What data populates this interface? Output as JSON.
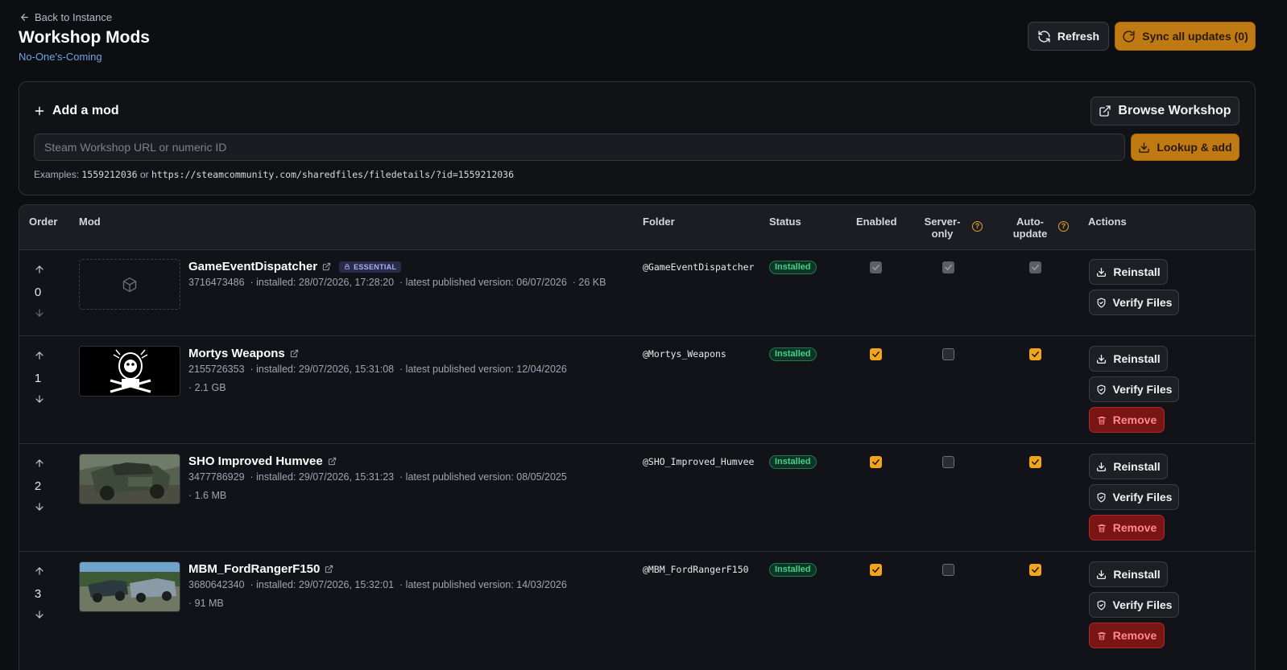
{
  "header": {
    "back_label": "Back to Instance",
    "title": "Workshop Mods",
    "subtitle": "No-One's-Coming",
    "refresh_label": "Refresh",
    "sync_label": "Sync all updates (0)"
  },
  "add_mod": {
    "title": "Add a mod",
    "browse_label": "Browse Workshop",
    "input_placeholder": "Steam Workshop URL or numeric ID",
    "input_value": "",
    "lookup_label": "Lookup & add",
    "examples_prefix": "Examples:",
    "example_id": "1559212036",
    "examples_or": "or",
    "example_url": "https://steamcommunity.com/sharedfiles/filedetails/?id=1559212036"
  },
  "table": {
    "columns": {
      "order": "Order",
      "mod": "Mod",
      "folder": "Folder",
      "status": "Status",
      "enabled": "Enabled",
      "server_only": "Server-only",
      "server_only_l1": "Server-",
      "server_only_l2": "only",
      "auto_update_l1": "Auto-",
      "auto_update_l2": "update",
      "actions": "Actions"
    },
    "actions": {
      "reinstall": "Reinstall",
      "verify": "Verify Files",
      "remove": "Remove"
    },
    "rows": [
      {
        "order": "0",
        "name": "GameEventDispatcher",
        "badge": "ESSENTIAL",
        "id": "3716473486",
        "installed": "· installed: 28/07/2026, 17:28:20",
        "latest": "· latest published version: 06/07/2026",
        "size": "· 26 KB",
        "folder": "@GameEventDispatcher",
        "status": "Installed",
        "enabled": true,
        "server_only": true,
        "auto_update": true,
        "locked": true
      },
      {
        "order": "1",
        "name": "Mortys Weapons",
        "id": "2155726353",
        "installed": "· installed: 29/07/2026, 15:31:08",
        "latest": "· latest published version: 12/04/2026",
        "size": "· 2.1 GB",
        "folder": "@Mortys_Weapons",
        "status": "Installed",
        "enabled": true,
        "server_only": false,
        "auto_update": true
      },
      {
        "order": "2",
        "name": "SHO Improved Humvee",
        "id": "3477786929",
        "installed": "· installed: 29/07/2026, 15:31:23",
        "latest": "· latest published version: 08/05/2025",
        "size": "· 1.6 MB",
        "folder": "@SHO_Improved_Humvee",
        "status": "Installed",
        "enabled": true,
        "server_only": false,
        "auto_update": true
      },
      {
        "order": "3",
        "name": "MBM_FordRangerF150",
        "id": "3680642340",
        "installed": "· installed: 29/07/2026, 15:32:01",
        "latest": "· latest published version: 14/03/2026",
        "size": "· 91 MB",
        "folder": "@MBM_FordRangerF150",
        "status": "Installed",
        "enabled": true,
        "server_only": false,
        "auto_update": true
      }
    ]
  },
  "colors": {
    "accent": "#c07a14",
    "checkbox_on": "#f1a51c",
    "status_green": "#3ed48b",
    "remove_red": "#b02a2a",
    "subtitle_blue": "#6fa3e6"
  }
}
